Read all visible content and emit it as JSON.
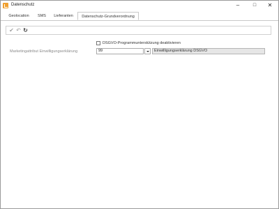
{
  "window": {
    "title": "Datenschutz",
    "minimize_glyph": "–",
    "maximize_glyph": "□",
    "close_glyph": "✕"
  },
  "tabs": [
    {
      "label": "Geolocation"
    },
    {
      "label": "SMS"
    },
    {
      "label": "Lieferanten"
    },
    {
      "label": "Datenschutz-Grundverordnung",
      "active": true
    }
  ],
  "toolbar": {
    "icons": [
      "checkmark-icon",
      "undo-icon",
      "refresh-icon"
    ],
    "check_glyph": "✔",
    "undo_glyph": "↶",
    "refresh_glyph": "↻"
  },
  "form": {
    "checkbox_label": "DSGVO-Programmunterstützung deaktivieren",
    "checkbox_checked": false,
    "field_label": "Marketingattribut Einwilligungserklärung",
    "field_value": "99",
    "field_description": "Einwilligungserklärung DSGVO"
  },
  "colors": {
    "app_icon": "#f0a030",
    "toolbar_icon_disabled": "#a0a0a0",
    "toolbar_icon_active": "#333333",
    "readonly_bg": "#e6e6e6"
  }
}
